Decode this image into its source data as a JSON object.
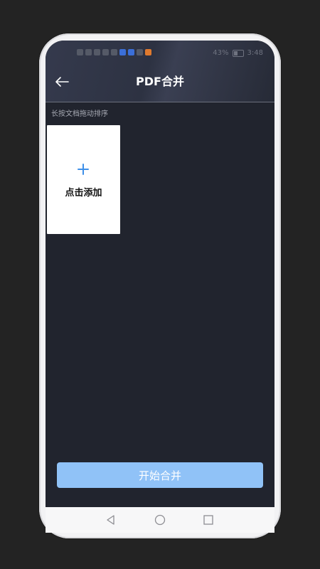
{
  "status_bar": {
    "battery_percent": "43%",
    "time": "3:48"
  },
  "header": {
    "title": "PDF合并"
  },
  "main": {
    "hint": "长按文档拖动排序",
    "add_card_label": "点击添加"
  },
  "footer": {
    "start_label": "开始合并"
  },
  "colors": {
    "accent": "#90c2f7",
    "plus": "#3d8fe8",
    "background": "#21242e"
  },
  "icons": {
    "back": "arrow-left-icon",
    "add": "plus-icon",
    "nav_back": "triangle-back-icon",
    "nav_home": "circle-home-icon",
    "nav_recent": "square-recent-icon"
  }
}
